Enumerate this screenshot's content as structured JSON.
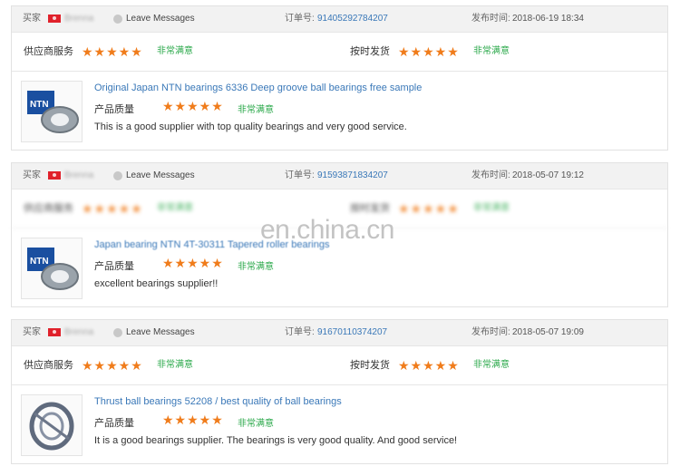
{
  "labels": {
    "buyer": "买家",
    "leave_messages": "Leave Messages",
    "order_no": "订单号:",
    "published": "发布时间:",
    "supplier_service": "供应商服务",
    "on_time": "按时发货",
    "quality": "产品质量",
    "satisfied": "非常满意",
    "stars": "★★★★★"
  },
  "watermark": "en.china.cn",
  "reviews": [
    {
      "buyer_name": "Brenna",
      "order_no": "91405292784207",
      "date": "2018-06-19 18:34",
      "product_title": "Original Japan NTN bearings 6336 Deep groove ball bearings free sample",
      "comment": "This is a good supplier with top quality bearings and very good service.",
      "supplier_rating": 5,
      "shipping_rating": 5,
      "quality_rating": 5,
      "image_icon": "ntn-bearing-box-image"
    },
    {
      "buyer_name": "Brenna",
      "order_no": "91593871834207",
      "date": "2018-05-07 19:12",
      "product_title": "Japan bearing NTN 4T-30311 Tapered roller bearings",
      "comment": "excellent bearings supplier!!",
      "supplier_rating": 5,
      "shipping_rating": 5,
      "quality_rating": 5,
      "image_icon": "ntn-bearing-box-image"
    },
    {
      "buyer_name": "Brenna",
      "order_no": "91670110374207",
      "date": "2018-05-07 19:09",
      "product_title": "Thrust ball bearings 52208 / best quality of ball bearings",
      "comment": "It is a good bearings supplier. The bearings is very good quality. And good service!",
      "supplier_rating": 5,
      "shipping_rating": 5,
      "quality_rating": 5,
      "image_icon": "thrust-bearing-image"
    }
  ]
}
